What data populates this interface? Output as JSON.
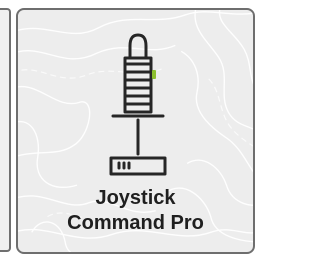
{
  "tile": {
    "label_line1": "Joystick",
    "label_line2": "Command Pro",
    "icon": "joystick-icon",
    "indicator_color": "#8cbf2f"
  }
}
